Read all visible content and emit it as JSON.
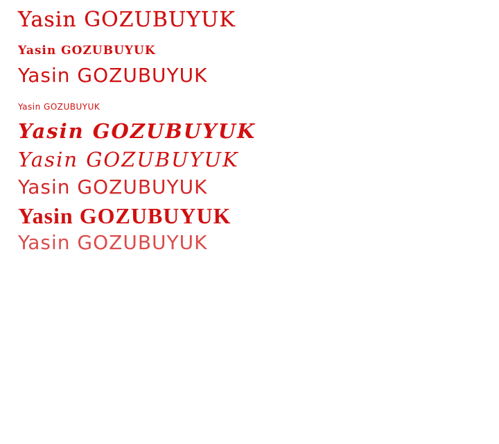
{
  "colors": {
    "background": "#ffffff",
    "text": "#d01010"
  },
  "font_samples": [
    {
      "text": "Yasin GOZUBUYUK"
    },
    {
      "text": "Yasin GOZUBUYUK"
    },
    {
      "text": "Yasin GOZUBUYUK"
    },
    {
      "text": "Yasin GOZUBUYUK"
    },
    {
      "text": "Yasin GOZUBUYUK"
    },
    {
      "text": "Yasin GOZUBUYUK"
    },
    {
      "text": "Yasin GOZUBUYUK"
    },
    {
      "text": "Yasin GOZUBUYUK"
    },
    {
      "text": "Yasin GOZUBUYUK"
    }
  ]
}
